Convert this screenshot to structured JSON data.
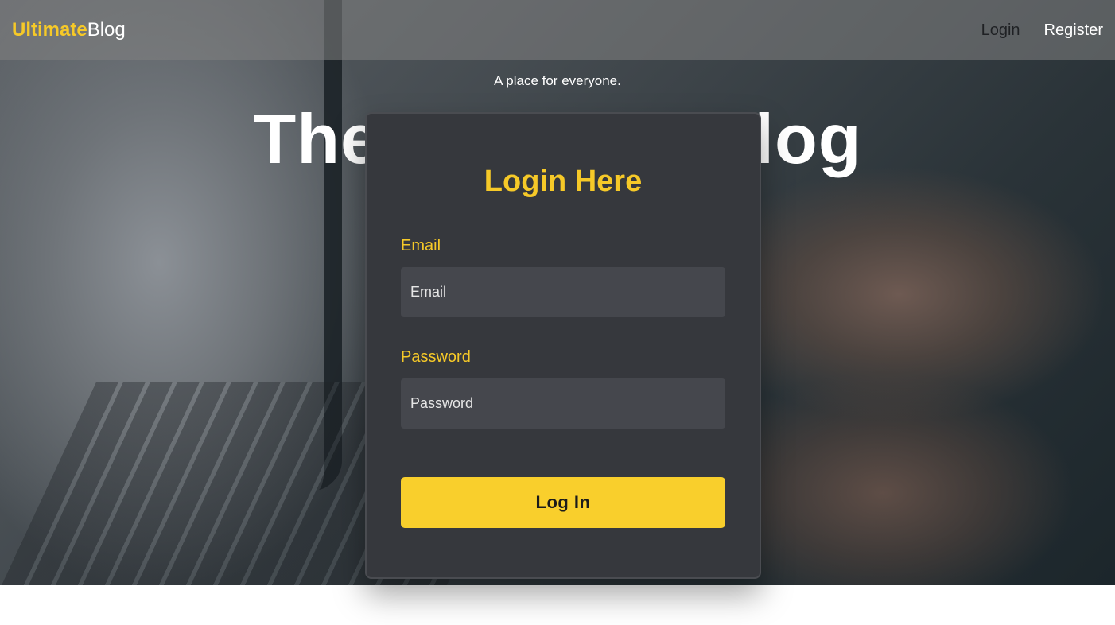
{
  "navbar": {
    "brand_accent": "Ultimate",
    "brand_rest": "Blog",
    "links": [
      {
        "label": "Login"
      },
      {
        "label": "Register"
      }
    ]
  },
  "hero": {
    "tagline": "A place for everyone.",
    "title": "The Ultimate Blog"
  },
  "login_card": {
    "title": "Login Here",
    "email_label": "Email",
    "email_placeholder": "Email",
    "email_value": "",
    "password_label": "Password",
    "password_placeholder": "Password",
    "password_value": "",
    "submit_label": "Log In"
  },
  "colors": {
    "accent": "#f6c928",
    "card_background": "#36383d",
    "input_background": "#45474d",
    "button_background": "#f9cf2c"
  }
}
